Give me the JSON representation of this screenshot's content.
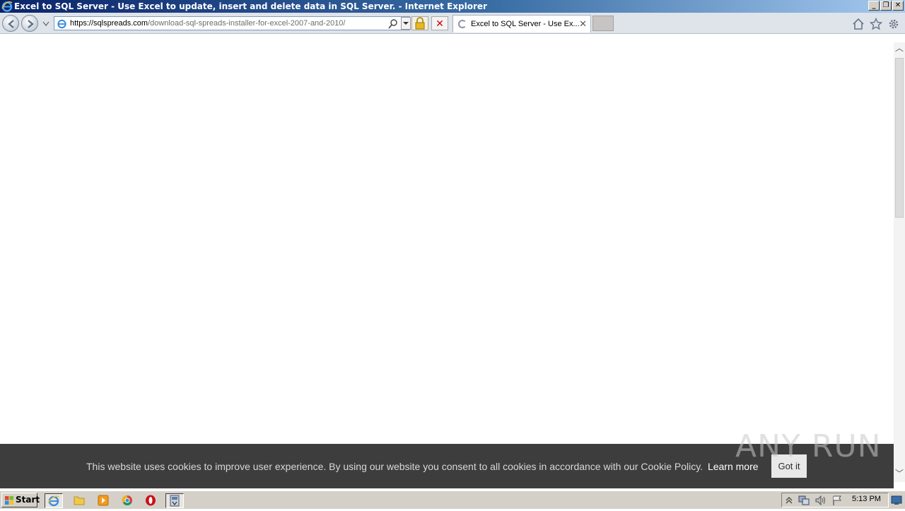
{
  "window": {
    "title": "Excel to SQL Server - Use Excel to update, insert and delete data in SQL Server. - Internet Explorer",
    "minimize_label": "_",
    "restore_label": "❐",
    "close_label": "✕"
  },
  "navbar": {
    "url_host": "https://sqlspreads.com",
    "url_path": "/download-sql-spreads-installer-for-excel-2007-and-2010/",
    "stop_label": "✕",
    "tab_title": "Excel to SQL Server - Use Ex...",
    "tab_close": "✕"
  },
  "cookie_banner": {
    "message": "This website uses cookies to improve user experience. By using our website you consent to all cookies in accordance with our Cookie Policy.",
    "learn_more": "Learn more",
    "button": "Got it"
  },
  "watermark": "ANY RUN",
  "taskbar": {
    "start_label": "Start",
    "clock": "5:13 PM"
  },
  "scrollbar": {
    "up": "︿",
    "down": "﹀"
  },
  "colors": {
    "titlebar": "#0a246a",
    "cookie_bg": "#3d3d3d",
    "taskbar": "#d4d0c8"
  }
}
